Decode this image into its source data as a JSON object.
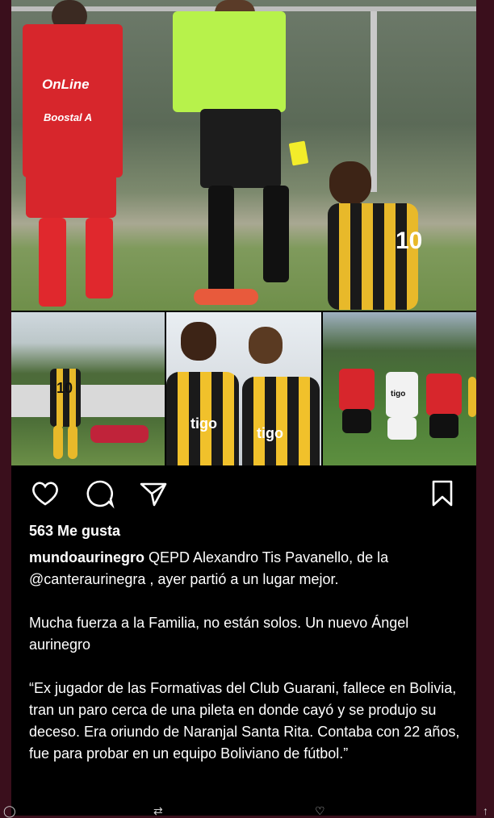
{
  "post": {
    "likes": "563 Me gusta",
    "username": "mundoaurinegro",
    "caption_line1": " QEPD Alexandro Tis Pavanello, de la @canteraurinegra , ayer partió a un lugar mejor.",
    "caption_p2": "Mucha fuerza a la Familia, no están solos. Un nuevo Ángel aurinegro",
    "caption_p3": "“Ex jugador de las Formativas del Club Guarani, fallece en Bolivia, tran un paro cerca de una pileta en donde cayó y se produjo su deceso. Era oriundo de Naranjal Santa Rita. Contaba con 22 años, fue para probar en un equipo Boliviano de fútbol.”"
  },
  "photo_text": {
    "red_sponsor": "OnLine",
    "red_sponsor2": "Boostal A",
    "shirt_number_main": "10",
    "shirt_number_thumb": "10",
    "tigo": "tigo"
  },
  "icons": [
    "heart-icon",
    "comment-icon",
    "share-icon",
    "bookmark-icon"
  ],
  "colors": {
    "background_border": "#3a0f1c",
    "post_bg": "#000000",
    "text": "#ffffff",
    "referee_green": "#b7f24b",
    "red_kit": "#d7262c",
    "yellow_kit": "#e8b92a"
  }
}
